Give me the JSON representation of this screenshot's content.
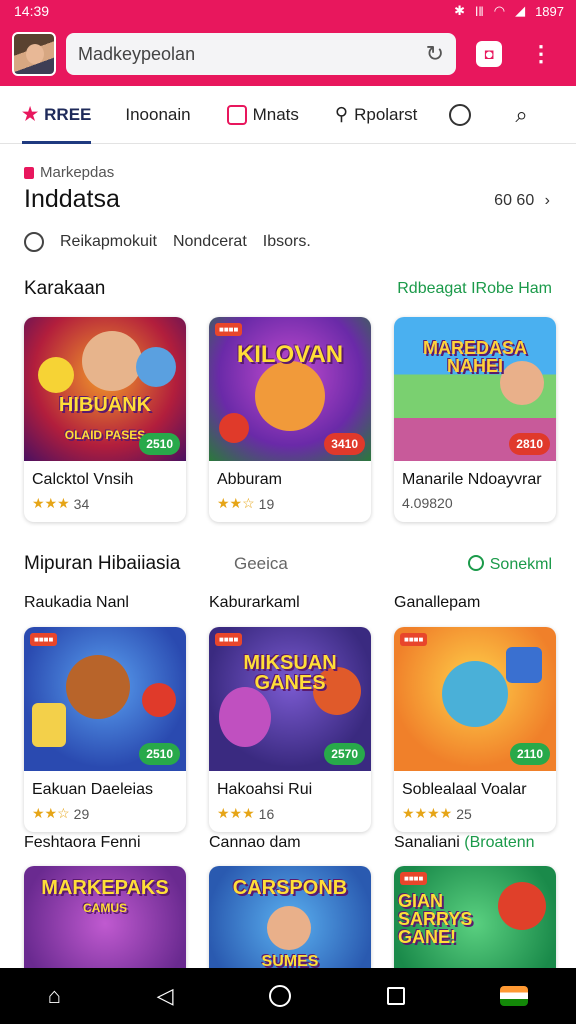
{
  "status": {
    "time": "14:39",
    "right": "1897"
  },
  "appbar": {
    "url": "Madkeypeolan"
  },
  "tabs": [
    {
      "label": "RREE"
    },
    {
      "label": "Inoonain"
    },
    {
      "label": "Mnats"
    },
    {
      "label": "Rpolarst"
    }
  ],
  "hero": {
    "overline": "Markepdas",
    "title": "Inddatsa",
    "count": "60 60"
  },
  "filters": {
    "a": "Reikapmokuit",
    "b": "Nondcerat",
    "c": "Ibsors."
  },
  "section1": {
    "title": "Karakaan",
    "link": "Rdbeagat IRobe Ham"
  },
  "section2": {
    "title": "Mipuran Hibaiiasia",
    "mid": "Geeica",
    "link": "Sonekml"
  },
  "row1": [
    {
      "art": "HIBUANK",
      "sub": "OLAID PASES",
      "chip": "2510",
      "name": "Calcktol Vnsih",
      "stars": "★★★",
      "rating": "34"
    },
    {
      "art": "KILOVAN",
      "sub": "",
      "chip": "3410",
      "name": "Abburam",
      "stars": "★★☆",
      "rating": "19"
    },
    {
      "art": "MAREDASA NAHEI",
      "sub": "",
      "chip": "2810",
      "name": "Manarile Ndoayvrar",
      "stars": "",
      "rating": "4.09820"
    }
  ],
  "labels2": [
    "Raukadia Nanl",
    "Kaburarkaml",
    "Ganallepam"
  ],
  "row2": [
    {
      "art": "",
      "sub": "",
      "chip": "2510",
      "name": "Eakuan Daeleias",
      "stars": "★★☆",
      "rating": "29"
    },
    {
      "art": "MIKSUAN GANES",
      "sub": "",
      "chip": "2570",
      "name": "Hakoahsi Rui",
      "stars": "★★★",
      "rating": "16"
    },
    {
      "art": "",
      "sub": "",
      "chip": "2110",
      "name": "Soblealaal Voalar",
      "stars": "★★★★",
      "rating": "25"
    }
  ],
  "labels3": [
    "Feshtaora Fenni",
    "Cannao dam",
    "Sanaliani"
  ],
  "label3_extra": "(Broatenn",
  "row3": [
    {
      "art": "MARKEPAKS",
      "sub": "CAMUS"
    },
    {
      "art": "CARSPONB",
      "sub": "SUMES"
    },
    {
      "art": "GIAN SARRYS GANE!",
      "sub": ""
    }
  ],
  "colors": {
    "accent": "#e8175d",
    "green": "#28a94a",
    "navy": "#1f3a80"
  }
}
